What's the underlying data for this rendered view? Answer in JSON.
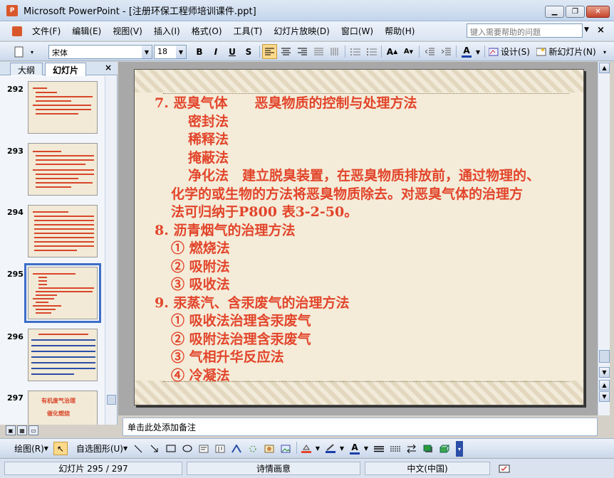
{
  "window": {
    "title": "Microsoft PowerPoint - [注册环保工程师培训课件.ppt]",
    "minimize_glyph": "▁",
    "restore_glyph": "❐",
    "close_glyph": "✕"
  },
  "menubar": {
    "items": [
      "文件(F)",
      "编辑(E)",
      "视图(V)",
      "插入(I)",
      "格式(O)",
      "工具(T)",
      "幻灯片放映(D)",
      "窗口(W)",
      "帮助(H)"
    ],
    "help_placeholder": "键入需要帮助的问题",
    "close_glyph": "×"
  },
  "toolbar": {
    "font_name": "宋体",
    "font_size": "18",
    "bold": "B",
    "italic": "I",
    "underline": "U",
    "shadow": "S",
    "grow_font": "A",
    "shrink_font": "A",
    "font_color": "A",
    "design_label": "设计(S)",
    "new_slide_label": "新幻灯片(N)"
  },
  "left_panel": {
    "tabs": [
      "大纲",
      "幻灯片"
    ],
    "active_tab": "幻灯片",
    "close_glyph": "×",
    "slides": [
      {
        "number": "292"
      },
      {
        "number": "293"
      },
      {
        "number": "294"
      },
      {
        "number": "295",
        "selected": true
      },
      {
        "number": "296"
      },
      {
        "number": "297"
      }
    ],
    "thumb_297_title": "有机废气治理",
    "thumb_297_subtitle": "催化燃烧"
  },
  "slide": {
    "lines": [
      {
        "text": "7. 恶臭气体　　恶臭物质的控制与处理方法",
        "indent": 0
      },
      {
        "text": "密封法",
        "indent": 2
      },
      {
        "text": "稀释法",
        "indent": 2
      },
      {
        "text": "掩蔽法",
        "indent": 2
      },
      {
        "text": "净化法　建立脱臭装置，在恶臭物质排放前，通过物理的、",
        "indent": 2
      },
      {
        "text": "化学的或生物的方法将恶臭物质除去。对恶臭气体的治理方",
        "indent": 1
      },
      {
        "text": "法可归纳于P800 表3-2-50。",
        "indent": 1
      },
      {
        "text": "8. 沥青烟气的治理方法",
        "indent": 0
      },
      {
        "text": "① 燃烧法",
        "indent": 1
      },
      {
        "text": "② 吸附法",
        "indent": 1
      },
      {
        "text": "③ 吸收法",
        "indent": 1
      },
      {
        "text": "9. 汞蒸汽、含汞废气的治理方法",
        "indent": 0
      },
      {
        "text": "① 吸收法治理含汞废气",
        "indent": 1
      },
      {
        "text": "② 吸附法治理含汞废气",
        "indent": 1
      },
      {
        "text": "③ 气相升华反应法",
        "indent": 1
      },
      {
        "text": "④ 冷凝法",
        "indent": 1
      }
    ]
  },
  "notes": {
    "placeholder": "单击此处添加备注"
  },
  "drawbar": {
    "draw_label": "绘图(R)",
    "autoshapes_label": "自选图形(U)"
  },
  "statusbar": {
    "slide_info": "幻灯片 295 / 297",
    "design_name": "诗情画意",
    "language": "中文(中国)"
  },
  "colors": {
    "slide_text": "#e2452b",
    "slide_bg": "#f4ecd9",
    "chrome_blue": "#cbd9ec"
  }
}
